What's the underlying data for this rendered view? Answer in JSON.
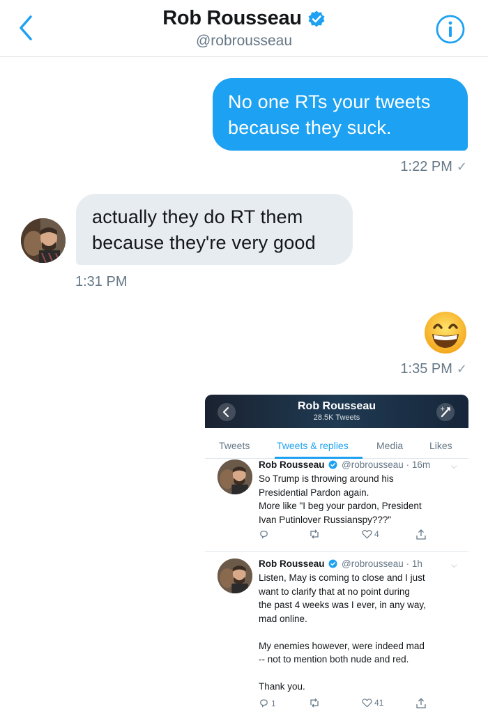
{
  "header": {
    "name": "Rob Rousseau",
    "handle": "@robrousseau",
    "verified": true,
    "accent_color": "#1da1f2"
  },
  "messages": [
    {
      "direction": "outgoing",
      "lines": [
        "No one RTs your tweets",
        "because they suck."
      ],
      "time": "1:22 PM"
    },
    {
      "direction": "incoming",
      "lines": [
        "actually they do RT them",
        "because they're very good"
      ],
      "time": "1:31 PM"
    },
    {
      "direction": "outgoing",
      "emoji": "grinning-face",
      "time": "1:35 PM"
    }
  ],
  "embedded_screenshot": {
    "title": "Rob Rousseau",
    "subtitle": "28.5K Tweets",
    "tabs": [
      "Tweets",
      "Tweets & replies",
      "Media",
      "Likes"
    ],
    "active_tab": "Tweets & replies",
    "tweets": [
      {
        "name": "Rob Rousseau",
        "handle": "@robrousseau",
        "age": "16m",
        "lines": [
          "So Trump is throwing around his",
          "Presidential Pardon again.",
          "More like \"I beg your pardon, President",
          "Ivan Putinlover Russianspy???\""
        ],
        "replies": "",
        "retweets": "",
        "likes": "4"
      },
      {
        "name": "Rob Rousseau",
        "handle": "@robrousseau",
        "age": "1h",
        "lines": [
          "Listen, May is coming to close and I just",
          "want to clarify that at no point during",
          "the past 4 weeks was I ever, in any way,",
          "mad online.",
          "",
          "My enemies however, were indeed mad",
          "-- not to mention both nude and red.",
          "",
          "Thank you."
        ],
        "replies": "1",
        "retweets": "",
        "likes": "41"
      }
    ]
  }
}
